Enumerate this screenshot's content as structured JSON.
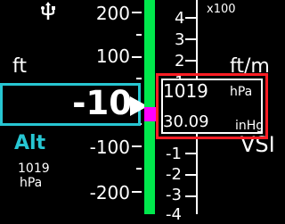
{
  "top": {
    "icon": "usb-trident",
    "multiplier": "x100"
  },
  "altimeter": {
    "unit": "ft",
    "label": "Alt",
    "value": "-10",
    "ticks": [
      "200",
      "100",
      "-100",
      "-200"
    ],
    "baro_small": {
      "value": "1019",
      "unit": "hPa"
    }
  },
  "vsi": {
    "unit": "ft/m",
    "label": "VSI",
    "ticks_pos": [
      "4",
      "3",
      "2",
      "1"
    ],
    "ticks_neg": [
      "1",
      "2",
      "3",
      "4"
    ],
    "bar_color": "#00e84c"
  },
  "baro_readout": {
    "hpa_value": "1019",
    "hpa_unit": "hPa",
    "inhg_value": "30.09",
    "inhg_unit": "inHg"
  },
  "colors": {
    "accent_cyan": "#27c6d2",
    "alert_red": "#ff1d24",
    "pointer_magenta": "#ff00ff"
  }
}
